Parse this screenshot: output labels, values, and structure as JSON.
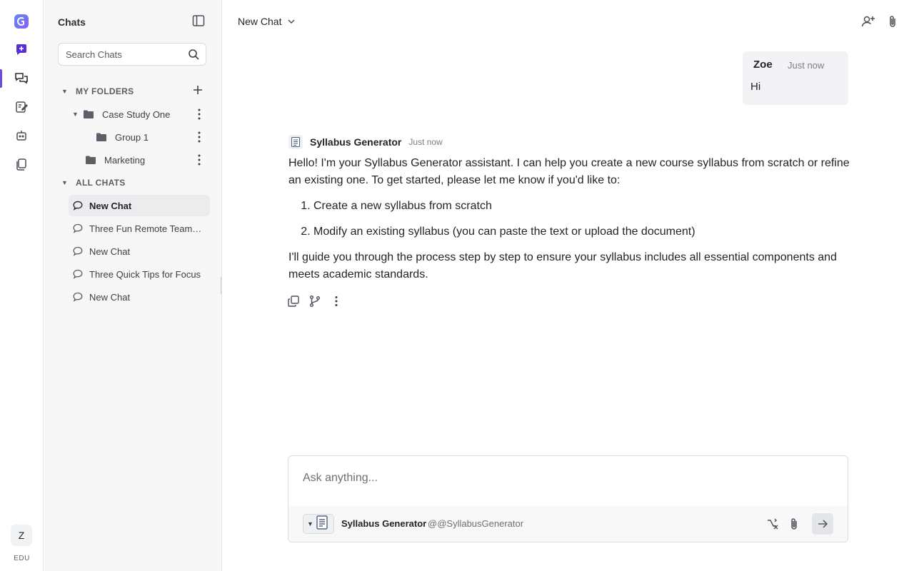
{
  "rail": {
    "avatar_initial": "Z",
    "org_label": "EDU",
    "icons": [
      "app-logo-icon",
      "new-chat-icon",
      "chats-icon",
      "notes-icon",
      "bots-icon",
      "files-icon"
    ]
  },
  "sidebar": {
    "title": "Chats",
    "search_placeholder": "Search Chats",
    "folders_header": "MY FOLDERS",
    "folders": [
      {
        "label": "Case Study One",
        "expanded": true
      },
      {
        "label": "Group 1",
        "expanded": false
      },
      {
        "label": "Marketing",
        "expanded": false
      }
    ],
    "all_chats_header": "ALL CHATS",
    "chats": [
      {
        "label": "New Chat",
        "active": true
      },
      {
        "label": "Three Fun Remote Team Building Activities",
        "active": false
      },
      {
        "label": "New Chat",
        "active": false
      },
      {
        "label": "Three Quick Tips for Focus",
        "active": false
      },
      {
        "label": "New Chat",
        "active": false
      }
    ]
  },
  "header": {
    "title": "New Chat"
  },
  "user_message": {
    "name": "Zoe",
    "time": "Just now",
    "text": "Hi"
  },
  "bot_message": {
    "name": "Syllabus Generator",
    "time": "Just now",
    "intro": "Hello! I'm your Syllabus Generator assistant. I can help you create a new course syllabus from scratch or refine an existing one. To get started, please let me know if you'd like to:",
    "options": [
      "Create a new syllabus from scratch",
      "Modify an existing syllabus (you can paste the text or upload the document)"
    ],
    "outro": "I'll guide you through the process step by step to ensure your syllabus includes all essential components and meets academic standards."
  },
  "composer": {
    "placeholder": "Ask anything...",
    "agent_name": "Syllabus Generator",
    "agent_handle": "@@SyllabusGenerator"
  },
  "colors": {
    "accent": "#6d4ae0",
    "sidebar_bg": "#f7f7f8",
    "active_item_bg": "#ececee"
  }
}
